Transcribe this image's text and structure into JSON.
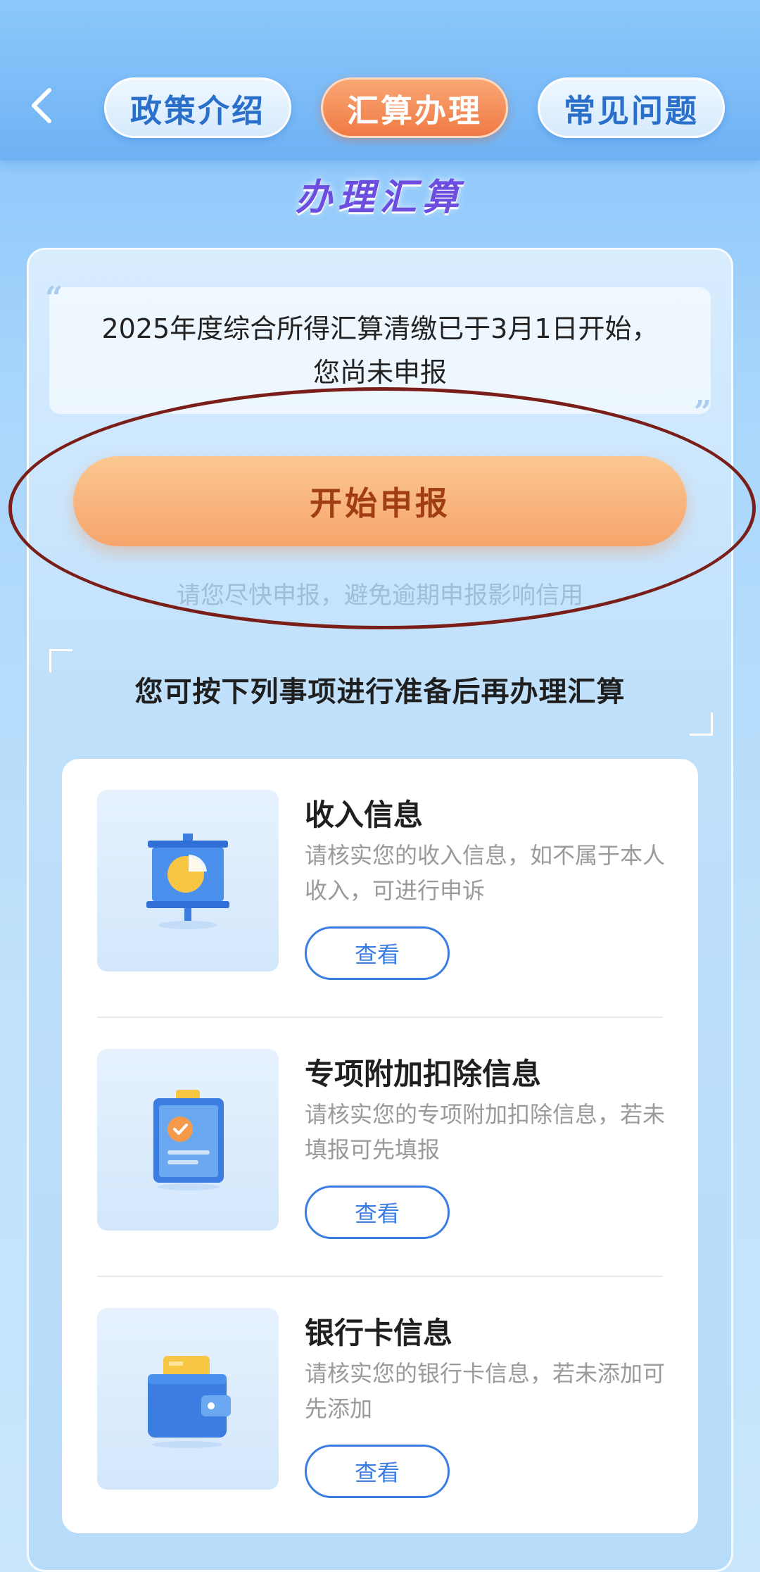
{
  "header": {
    "back_icon": "chevron-left-icon",
    "tabs": [
      {
        "label": "政策介绍",
        "active": false
      },
      {
        "label": "汇算办理",
        "active": true
      },
      {
        "label": "常见问题",
        "active": false
      }
    ]
  },
  "section_title": "办理汇算",
  "notice": {
    "line1": "2025年度综合所得汇算清缴已于3月1日开始，",
    "line2": "您尚未申报"
  },
  "start_button": "开始申报",
  "hint": "请您尽快申报，避免逾期申报影响信用",
  "prep_title": "您可按下列事项进行准备后再办理汇算",
  "items": [
    {
      "title": "收入信息",
      "desc": "请核实您的收入信息，如不属于本人收入，可进行申诉",
      "button": "查看",
      "icon": "presentation-chart-icon"
    },
    {
      "title": "专项附加扣除信息",
      "desc": "请核实您的专项附加扣除信息，若未填报可先填报",
      "button": "查看",
      "icon": "clipboard-check-icon"
    },
    {
      "title": "银行卡信息",
      "desc": "请核实您的银行卡信息，若未添加可先添加",
      "button": "查看",
      "icon": "wallet-icon"
    }
  ],
  "colors": {
    "accent_orange": "#f07a45",
    "accent_blue": "#3b7de0",
    "annotation_oval": "#7a1e1a"
  }
}
